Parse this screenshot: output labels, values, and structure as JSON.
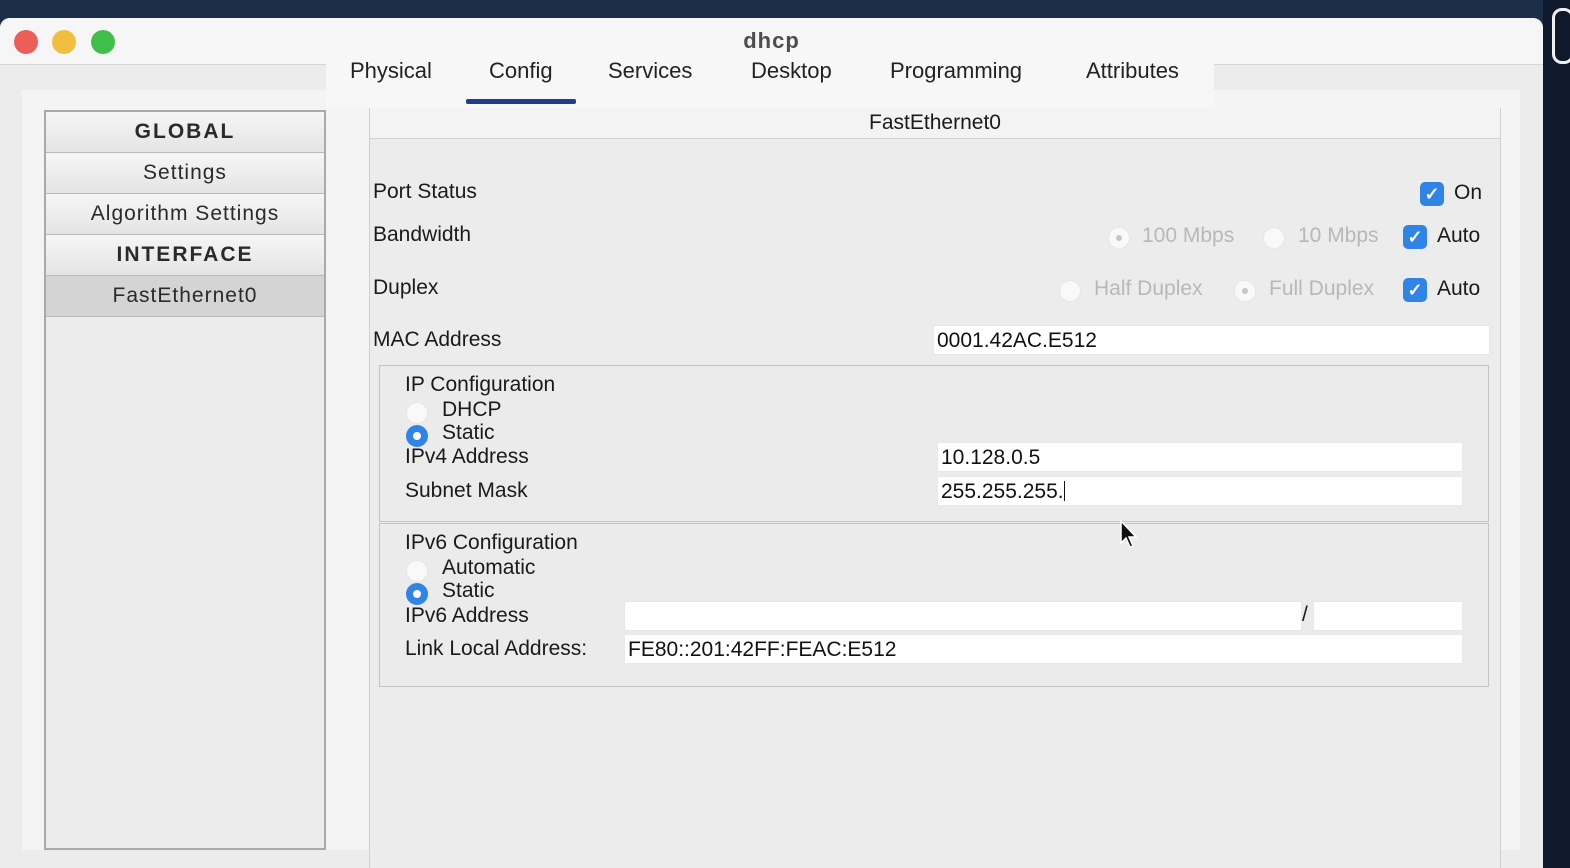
{
  "window": {
    "title": "dhcp"
  },
  "tabs": [
    {
      "label": "Physical"
    },
    {
      "label": "Config"
    },
    {
      "label": "Services"
    },
    {
      "label": "Desktop"
    },
    {
      "label": "Programming"
    },
    {
      "label": "Attributes"
    }
  ],
  "sidebar": {
    "items": [
      {
        "label": "GLOBAL"
      },
      {
        "label": "Settings"
      },
      {
        "label": "Algorithm Settings"
      },
      {
        "label": "INTERFACE"
      },
      {
        "label": "FastEthernet0"
      }
    ]
  },
  "interface": {
    "name": "FastEthernet0",
    "port_status": {
      "label": "Port Status",
      "on_label": "On",
      "checked": true
    },
    "bandwidth": {
      "label": "Bandwidth",
      "opt_100": "100 Mbps",
      "opt_10": "10 Mbps",
      "auto_label": "Auto"
    },
    "duplex": {
      "label": "Duplex",
      "opt_half": "Half Duplex",
      "opt_full": "Full Duplex",
      "auto_label": "Auto"
    },
    "mac": {
      "label": "MAC Address",
      "value": "0001.42AC.E512"
    },
    "ipv4": {
      "title": "IP Configuration",
      "dhcp_label": "DHCP",
      "static_label": "Static",
      "selected": "Static",
      "address_label": "IPv4 Address",
      "address_value": "10.128.0.5",
      "mask_label": "Subnet Mask",
      "mask_value": "255.255.255."
    },
    "ipv6": {
      "title": "IPv6 Configuration",
      "auto_label": "Automatic",
      "static_label": "Static",
      "selected": "Static",
      "address_label": "IPv6 Address",
      "address_value": "",
      "slash": "/",
      "prefix_value": "",
      "link_local_label": "Link Local Address:",
      "link_local_value": "FE80::201:42FF:FEAC:E512"
    }
  },
  "colors": {
    "accent": "#2f84e6",
    "tab_underline": "#1f3f8a"
  }
}
